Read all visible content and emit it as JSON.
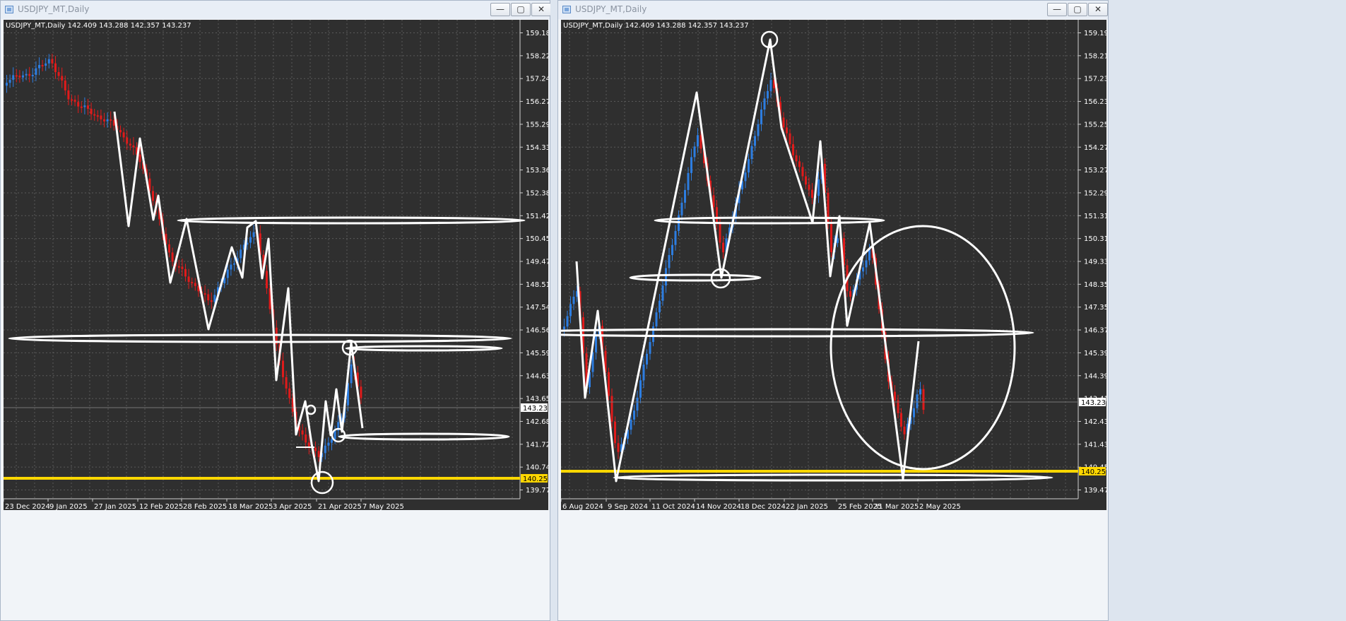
{
  "windows": [
    {
      "id": "left",
      "title": "USDJPY_MT,Daily",
      "chart_label": "USDJPY_MT,Daily  142.409 143.288 142.357 143.237",
      "price_levels": [
        "159.180",
        "158.220",
        "157.245",
        "156.270",
        "155.295",
        "154.335",
        "153.360",
        "152.385",
        "151.425",
        "150.450",
        "149.475",
        "148.515",
        "147.540",
        "146.565",
        "145.590",
        "144.630",
        "143.655",
        "142.680",
        "141.720",
        "140.745",
        "139.770"
      ],
      "date_labels": [
        "23 Dec 2024",
        "9 Jan 2025",
        "27 Jan 2025",
        "12 Feb 2025",
        "28 Feb 2025",
        "18 Mar 2025",
        "3 Apr 2025",
        "21 Apr 2025",
        "7 May 2025"
      ],
      "current_price": "143.237",
      "support_price": "140.250"
    },
    {
      "id": "right",
      "title": "USDJPY_MT,Daily",
      "chart_label": "USDJPY_MT,Daily  142.409 143.288 142.357 143.237",
      "price_levels": [
        "159.190",
        "158.210",
        "157.230",
        "156.230",
        "155.250",
        "154.270",
        "153.270",
        "152.290",
        "151.310",
        "150.310",
        "149.330",
        "148.350",
        "147.350",
        "146.370",
        "145.390",
        "144.390",
        "143.410",
        "142.430",
        "141.430",
        "140.450",
        "139.470"
      ],
      "date_labels": [
        "6 Aug 2024",
        "9 Sep 2024",
        "11 Oct 2024",
        "14 Nov 2024",
        "18 Dec 2024",
        "22 Jan 2025",
        "25 Feb 2025",
        "31 Mar 2025",
        "2 May 2025"
      ],
      "current_price": "143.237",
      "support_price": "140.250"
    }
  ],
  "buttons": {
    "minimize": "—",
    "maximize": "▢",
    "close": "✕"
  },
  "colors": {
    "background": "#2f2f2f",
    "grid": "#5a5a5a",
    "bull": "#2d7de0",
    "bear": "#e01b1b",
    "support": "#ffd700",
    "annotation": "#ffffff",
    "axis_text": "#ffffff"
  }
}
